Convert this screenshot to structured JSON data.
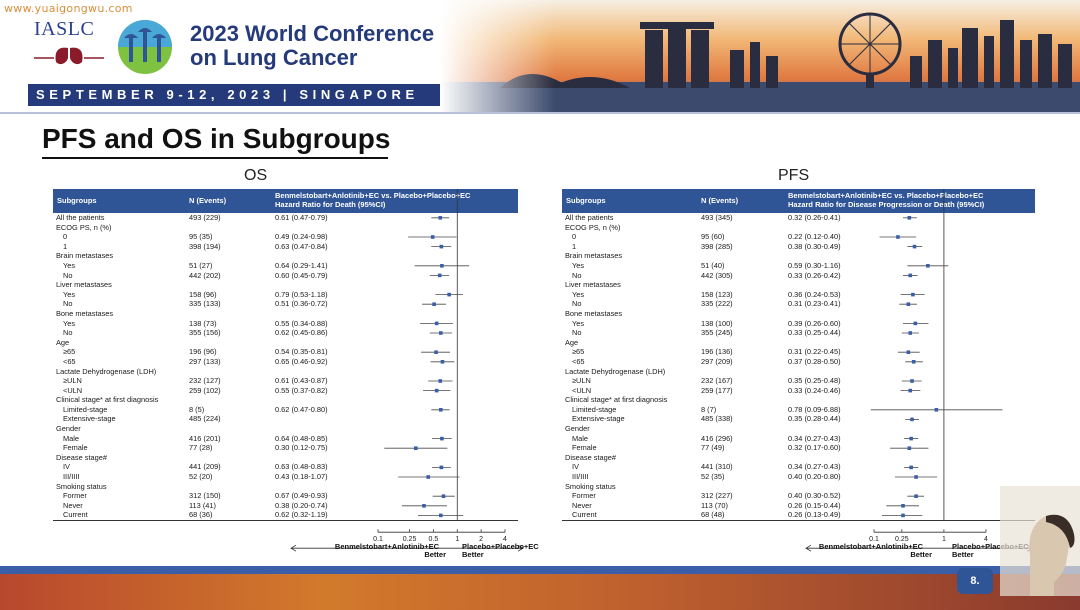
{
  "header": {
    "watermark": "www.yuaigongwu.com",
    "org": "IASLC",
    "conference_line1": "2023 World Conference",
    "conference_line2": "on Lung Cancer",
    "date_location": "SEPTEMBER 9-12, 2023 | SINGAPORE"
  },
  "slide": {
    "title": "PFS and OS in Subgroups",
    "page_number": "8."
  },
  "os": {
    "panel_title": "OS",
    "headers": {
      "subgroups": "Subgroups",
      "n": "N (Events)",
      "comparison": "Benmelstobart+Anlotinib+EC  vs. Placebo+Placebo+EC",
      "hr": "Hazard Ratio for Death (95%CI)"
    },
    "rows": [
      {
        "label": "All the patients",
        "n": "493 (229)",
        "hr_text": "0.61 (0.47-0.79)",
        "hr": 0.61,
        "lo": 0.47,
        "hi": 0.79
      },
      {
        "label": "ECOG PS, n (%)"
      },
      {
        "label": "0",
        "n": "95 (35)",
        "hr_text": "0.49 (0.24-0.98)",
        "hr": 0.49,
        "lo": 0.24,
        "hi": 0.98
      },
      {
        "label": "1",
        "n": "398 (194)",
        "hr_text": "0.63 (0.47-0.84)",
        "hr": 0.63,
        "lo": 0.47,
        "hi": 0.84
      },
      {
        "label": "Brain metastases"
      },
      {
        "label": "Yes",
        "n": "51 (27)",
        "hr_text": "0.64 (0.29-1.41)",
        "hr": 0.64,
        "lo": 0.29,
        "hi": 1.41
      },
      {
        "label": "No",
        "n": "442 (202)",
        "hr_text": "0.60 (0.45-0.79)",
        "hr": 0.6,
        "lo": 0.45,
        "hi": 0.79
      },
      {
        "label": "Liver metastases"
      },
      {
        "label": "Yes",
        "n": "158 (96)",
        "hr_text": "0.79 (0.53-1.18)",
        "hr": 0.79,
        "lo": 0.53,
        "hi": 1.18
      },
      {
        "label": "No",
        "n": "335 (133)",
        "hr_text": "0.51 (0.36-0.72)",
        "hr": 0.51,
        "lo": 0.36,
        "hi": 0.72
      },
      {
        "label": "Bone metastases"
      },
      {
        "label": "Yes",
        "n": "138 (73)",
        "hr_text": "0.55 (0.34-0.88)",
        "hr": 0.55,
        "lo": 0.34,
        "hi": 0.88
      },
      {
        "label": "No",
        "n": "355 (156)",
        "hr_text": "0.62 (0.45-0.86)",
        "hr": 0.62,
        "lo": 0.45,
        "hi": 0.86
      },
      {
        "label": "Age"
      },
      {
        "label": "≥65",
        "n": "196 (96)",
        "hr_text": "0.54 (0.35-0.81)",
        "hr": 0.54,
        "lo": 0.35,
        "hi": 0.81
      },
      {
        "label": "<65",
        "n": "297 (133)",
        "hr_text": "0.65 (0.46-0.92)",
        "hr": 0.65,
        "lo": 0.46,
        "hi": 0.92
      },
      {
        "label": "Lactate Dehydrogenase (LDH)"
      },
      {
        "label": "≥ULN",
        "n": "232 (127)",
        "hr_text": "0.61 (0.43-0.87)",
        "hr": 0.61,
        "lo": 0.43,
        "hi": 0.87
      },
      {
        "label": "<ULN",
        "n": "259 (102)",
        "hr_text": "0.55 (0.37-0.82)",
        "hr": 0.55,
        "lo": 0.37,
        "hi": 0.82
      },
      {
        "label": "Clinical stage* at first diagnosis"
      },
      {
        "label": "Limited-stage",
        "n": "8 (5)",
        "hr_text": "0.62 (0.47-0.80)",
        "hr": 0.62,
        "lo": 0.47,
        "hi": 0.8
      },
      {
        "label": "Extensive-stage",
        "n": "485 (224)",
        "hr_text": ""
      },
      {
        "label": "Gender"
      },
      {
        "label": "Male",
        "n": "416 (201)",
        "hr_text": "0.64 (0.48-0.85)",
        "hr": 0.64,
        "lo": 0.48,
        "hi": 0.85
      },
      {
        "label": "Female",
        "n": "77 (28)",
        "hr_text": "0.30 (0.12-0.75)",
        "hr": 0.3,
        "lo": 0.12,
        "hi": 0.75
      },
      {
        "label": "Disease stage#"
      },
      {
        "label": "IV",
        "n": "441 (209)",
        "hr_text": "0.63 (0.48-0.83)",
        "hr": 0.63,
        "lo": 0.48,
        "hi": 0.83
      },
      {
        "label": "III/IIII",
        "n": "52 (20)",
        "hr_text": "0.43 (0.18-1.07)",
        "hr": 0.43,
        "lo": 0.18,
        "hi": 1.07
      },
      {
        "label": "Smoking status"
      },
      {
        "label": "Former",
        "n": "312 (150)",
        "hr_text": "0.67 (0.49-0.93)",
        "hr": 0.67,
        "lo": 0.49,
        "hi": 0.93
      },
      {
        "label": "Never",
        "n": "113 (41)",
        "hr_text": "0.38 (0.20-0.74)",
        "hr": 0.38,
        "lo": 0.2,
        "hi": 0.74
      },
      {
        "label": "Current",
        "n": "68 (36)",
        "hr_text": "0.62 (0.32-1.19)",
        "hr": 0.62,
        "lo": 0.32,
        "hi": 1.19
      }
    ],
    "axis": {
      "ticks": [
        0.1,
        0.25,
        0.5,
        1,
        2,
        4
      ],
      "tick_labels": [
        "0.1",
        "0.25",
        "0.5",
        "1",
        "2",
        "4"
      ],
      "left_label_1": "Benmelstobart+Anlotinib+EC",
      "left_label_2": "Better",
      "right_label_1": "Placebo+Placebo+EC",
      "right_label_2": "Better"
    }
  },
  "pfs": {
    "panel_title": "PFS",
    "headers": {
      "subgroups": "Subgroups",
      "n": "N (Events)",
      "comparison": "Benmelstobart+Anlotinib+EC  vs. Placebo+Placebo+EC",
      "hr": "Hazard Ratio for Disease Progression or Death (95%CI)"
    },
    "rows": [
      {
        "label": "All the patients",
        "n": "493 (345)",
        "hr_text": "0.32 (0.26-0.41)",
        "hr": 0.32,
        "lo": 0.26,
        "hi": 0.41
      },
      {
        "label": "ECOG PS, n (%)"
      },
      {
        "label": "0",
        "n": "95 (60)",
        "hr_text": "0.22 (0.12-0.40)",
        "hr": 0.22,
        "lo": 0.12,
        "hi": 0.4
      },
      {
        "label": "1",
        "n": "398 (285)",
        "hr_text": "0.38 (0.30-0.49)",
        "hr": 0.38,
        "lo": 0.3,
        "hi": 0.49
      },
      {
        "label": "Brain metastases"
      },
      {
        "label": "Yes",
        "n": "51 (40)",
        "hr_text": "0.59 (0.30-1.16)",
        "hr": 0.59,
        "lo": 0.3,
        "hi": 1.16
      },
      {
        "label": "No",
        "n": "442 (305)",
        "hr_text": "0.33 (0.26-0.42)",
        "hr": 0.33,
        "lo": 0.26,
        "hi": 0.42
      },
      {
        "label": "Liver metastases"
      },
      {
        "label": "Yes",
        "n": "158 (123)",
        "hr_text": "0.36 (0.24-0.53)",
        "hr": 0.36,
        "lo": 0.24,
        "hi": 0.53
      },
      {
        "label": "No",
        "n": "335 (222)",
        "hr_text": "0.31 (0.23-0.41)",
        "hr": 0.31,
        "lo": 0.23,
        "hi": 0.41
      },
      {
        "label": "Bone metastases"
      },
      {
        "label": "Yes",
        "n": "138 (100)",
        "hr_text": "0.39 (0.26-0.60)",
        "hr": 0.39,
        "lo": 0.26,
        "hi": 0.6
      },
      {
        "label": "No",
        "n": "355 (245)",
        "hr_text": "0.33 (0.25-0.44)",
        "hr": 0.33,
        "lo": 0.25,
        "hi": 0.44
      },
      {
        "label": "Age"
      },
      {
        "label": "≥65",
        "n": "196 (136)",
        "hr_text": "0.31 (0.22-0.45)",
        "hr": 0.31,
        "lo": 0.22,
        "hi": 0.45
      },
      {
        "label": "<65",
        "n": "297 (209)",
        "hr_text": "0.37 (0.28-0.50)",
        "hr": 0.37,
        "lo": 0.28,
        "hi": 0.5
      },
      {
        "label": "Lactate Dehydrogenase (LDH)"
      },
      {
        "label": "≥ULN",
        "n": "232 (167)",
        "hr_text": "0.35 (0.25-0.48)",
        "hr": 0.35,
        "lo": 0.25,
        "hi": 0.48
      },
      {
        "label": "<ULN",
        "n": "259 (177)",
        "hr_text": "0.33 (0.24-0.46)",
        "hr": 0.33,
        "lo": 0.24,
        "hi": 0.46
      },
      {
        "label": "Clinical stage* at first diagnosis"
      },
      {
        "label": "Limited-stage",
        "n": "8 (7)",
        "hr_text": "0.78 (0.09-6.88)",
        "hr": 0.78,
        "lo": 0.09,
        "hi": 6.88
      },
      {
        "label": "Extensive-stage",
        "n": "485 (338)",
        "hr_text": "0.35 (0.28-0.44)",
        "hr": 0.35,
        "lo": 0.28,
        "hi": 0.44
      },
      {
        "label": "Gender"
      },
      {
        "label": "Male",
        "n": "416 (296)",
        "hr_text": "0.34 (0.27-0.43)",
        "hr": 0.34,
        "lo": 0.27,
        "hi": 0.43
      },
      {
        "label": "Female",
        "n": "77 (49)",
        "hr_text": "0.32 (0.17-0.60)",
        "hr": 0.32,
        "lo": 0.17,
        "hi": 0.6
      },
      {
        "label": "Disease stage#"
      },
      {
        "label": "IV",
        "n": "441 (310)",
        "hr_text": "0.34 (0.27-0.43)",
        "hr": 0.34,
        "lo": 0.27,
        "hi": 0.43
      },
      {
        "label": "III/IIII",
        "n": "52 (35)",
        "hr_text": "0.40 (0.20-0.80)",
        "hr": 0.4,
        "lo": 0.2,
        "hi": 0.8
      },
      {
        "label": "Smoking status"
      },
      {
        "label": "Former",
        "n": "312 (227)",
        "hr_text": "0.40 (0.30-0.52)",
        "hr": 0.4,
        "lo": 0.3,
        "hi": 0.52
      },
      {
        "label": "Never",
        "n": "113 (70)",
        "hr_text": "0.26 (0.15-0.44)",
        "hr": 0.26,
        "lo": 0.15,
        "hi": 0.44
      },
      {
        "label": "Current",
        "n": "68 (48)",
        "hr_text": "0.26 (0.13-0.49)",
        "hr": 0.26,
        "lo": 0.13,
        "hi": 0.49
      }
    ],
    "axis": {
      "ticks": [
        0.1,
        0.25,
        1,
        4
      ],
      "tick_labels": [
        "0.1",
        "0.25",
        "1",
        "4"
      ],
      "left_label_1": "Benmelstobart+Anlotinib+EC",
      "left_label_2": "Better",
      "right_label_1": "Placebo+Placebo+EC",
      "right_label_2": "Better"
    }
  },
  "chart_data": [
    {
      "type": "scatter",
      "title": "OS",
      "xlabel": "",
      "ylabel": "",
      "x_scale": "log",
      "xlim": [
        0.1,
        4
      ],
      "reference_line": 1,
      "series_ref": "os.rows",
      "colors": {
        "marker": "#3a5fa8",
        "header": "#2f5597"
      }
    },
    {
      "type": "scatter",
      "title": "PFS",
      "xlabel": "",
      "ylabel": "",
      "x_scale": "log",
      "xlim": [
        0.1,
        4
      ],
      "reference_line": 1,
      "series_ref": "pfs.rows",
      "colors": {
        "marker": "#3a5fa8",
        "header": "#2f5597"
      }
    }
  ]
}
